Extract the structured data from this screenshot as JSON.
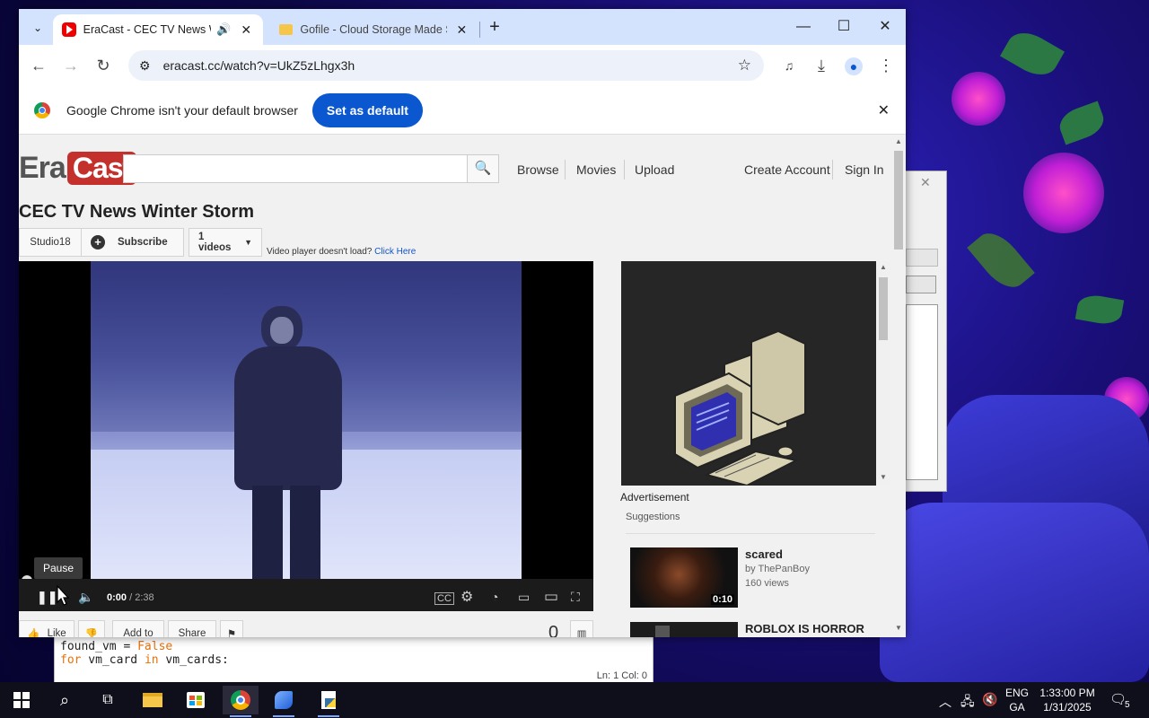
{
  "browser": {
    "tabs": [
      {
        "title": "EraCast - CEC TV News Wir",
        "active": true
      },
      {
        "title": "Gofile - Cloud Storage Made Si",
        "active": false
      }
    ],
    "url": "eracast.cc/watch?v=UkZ5zLhgx3h",
    "infobar": {
      "message": "Google Chrome isn't your default browser",
      "button": "Set as default"
    }
  },
  "site": {
    "logo_era": "Era",
    "logo_cast": "Cast",
    "nav": [
      "Browse",
      "Movies",
      "Upload"
    ],
    "account": [
      "Create Account",
      "Sign In"
    ]
  },
  "video": {
    "title": "CEC TV News Winter Storm",
    "channel": "Studio18",
    "subscribe": "Subscribe",
    "videos": "1 videos",
    "load_msg": "Video player doesn't load?",
    "load_link": "Click Here",
    "time_current": "0:00",
    "time_total": "/ 2:38",
    "tooltip": "Pause",
    "progress_fraction": 0.0,
    "buffered_fraction": 0.26,
    "actions": {
      "like": "Like",
      "add_to": "Add to",
      "share": "Share"
    },
    "view_count": "0"
  },
  "sidebar": {
    "advertisement": "Advertisement",
    "suggestions_label": "Suggestions",
    "suggestions": [
      {
        "title": "scared",
        "author": "by ThePanBoy",
        "views": "160 views",
        "duration": "0:10"
      },
      {
        "title": "ROBLOX IS HORROR GAME",
        "author": "",
        "views": "",
        "duration": ""
      }
    ]
  },
  "editor": {
    "line1_a": "found_vm = ",
    "line1_b": "False",
    "line2_kw1": "for",
    "line2_a": " vm_card ",
    "line2_kw2": "in",
    "line2_b": " vm_cards:",
    "status": "Ln: 1   Col: 0"
  },
  "taskbar": {
    "lang_top": "ENG",
    "lang_bottom": "GA",
    "time": "1:33:00 PM",
    "date": "1/31/2025",
    "notifications": "5"
  },
  "colors": {
    "brand_red": "#c4302b",
    "chrome_blue": "#0b57d0",
    "tab_strip": "#d3e3fd"
  }
}
